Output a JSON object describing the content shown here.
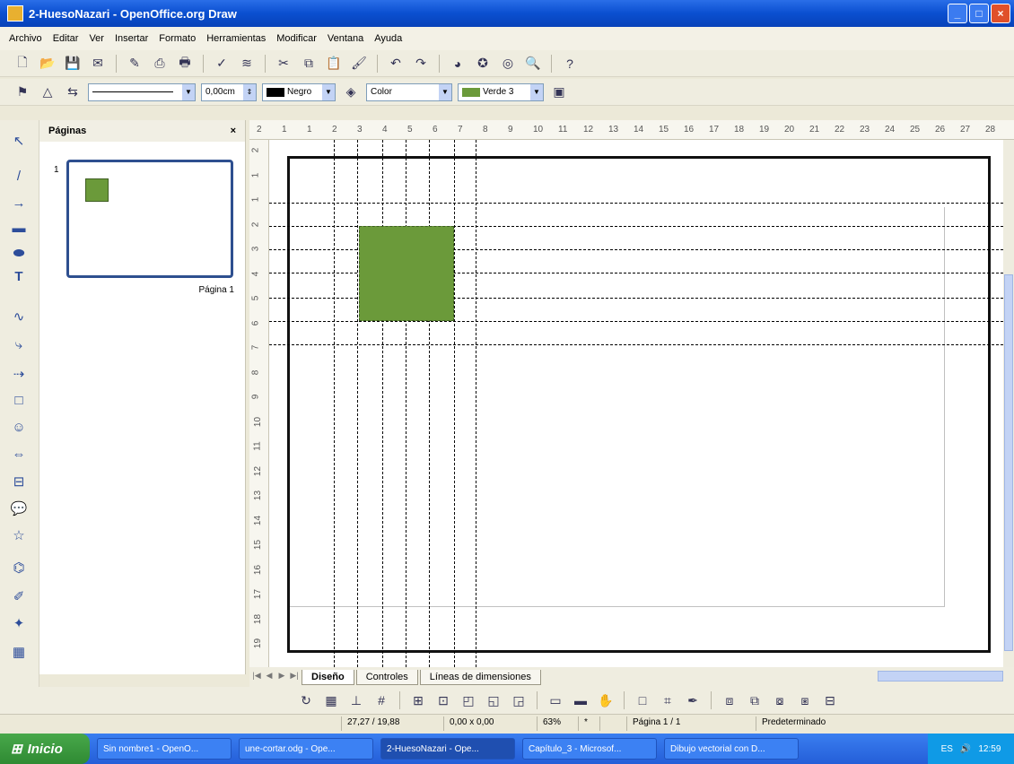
{
  "window": {
    "title": "2-HuesoNazari - OpenOffice.org Draw",
    "min": "_",
    "max": "□",
    "close": "×"
  },
  "menu": [
    "Archivo",
    "Editar",
    "Ver",
    "Insertar",
    "Formato",
    "Herramientas",
    "Modificar",
    "Ventana",
    "Ayuda"
  ],
  "line_toolbar": {
    "line_width": "0,00cm",
    "line_color": "Negro",
    "line_color_hex": "#000000",
    "area_style": "Color",
    "area_color": "Verde 3",
    "area_color_hex": "#6b9a3a"
  },
  "pages_panel": {
    "title": "Páginas",
    "close": "×",
    "page_number": "1",
    "page_name": "Página 1"
  },
  "hruler_ticks": [
    "2",
    "1",
    "1",
    "2",
    "3",
    "4",
    "5",
    "6",
    "7",
    "8",
    "9",
    "10",
    "11",
    "12",
    "13",
    "14",
    "15",
    "16",
    "17",
    "18",
    "19",
    "20",
    "21",
    "22",
    "23",
    "24",
    "25",
    "26",
    "27",
    "28"
  ],
  "vruler_ticks": [
    "2",
    "1",
    "1",
    "2",
    "3",
    "4",
    "5",
    "6",
    "7",
    "8",
    "9",
    "10",
    "11",
    "12",
    "13",
    "14",
    "15",
    "16",
    "17",
    "18",
    "19"
  ],
  "layer_tabs": [
    "Diseño",
    "Controles",
    "Líneas de dimensiones"
  ],
  "status": {
    "position": "27,27 / 19,88",
    "size": "0,00 x 0,00",
    "zoom": "63%",
    "modified": "*",
    "page": "Página 1 / 1",
    "layout": "Predeterminado"
  },
  "taskbar": {
    "start": "Inicio",
    "tasks": [
      "Sin nombre1 - OpenO...",
      "une-cortar.odg - Ope...",
      "2-HuesoNazari - Ope...",
      "Capítulo_3 - Microsof...",
      "Dibujo vectorial con D..."
    ],
    "lang": "ES",
    "clock": "12:59"
  }
}
